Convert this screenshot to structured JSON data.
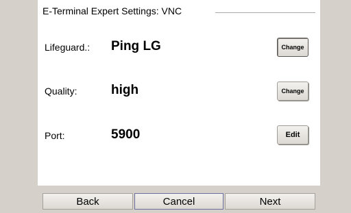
{
  "title": "E-Terminal Expert Settings: VNC",
  "settings": [
    {
      "label": "Lifeguard.:",
      "value": "Ping LG",
      "button": "Change"
    },
    {
      "label": "Quality:",
      "value": "high",
      "button": "Change"
    },
    {
      "label": "Port:",
      "value": "5900",
      "button": "Edit"
    }
  ],
  "nav": {
    "back": "Back",
    "cancel": "Cancel",
    "next": "Next"
  }
}
